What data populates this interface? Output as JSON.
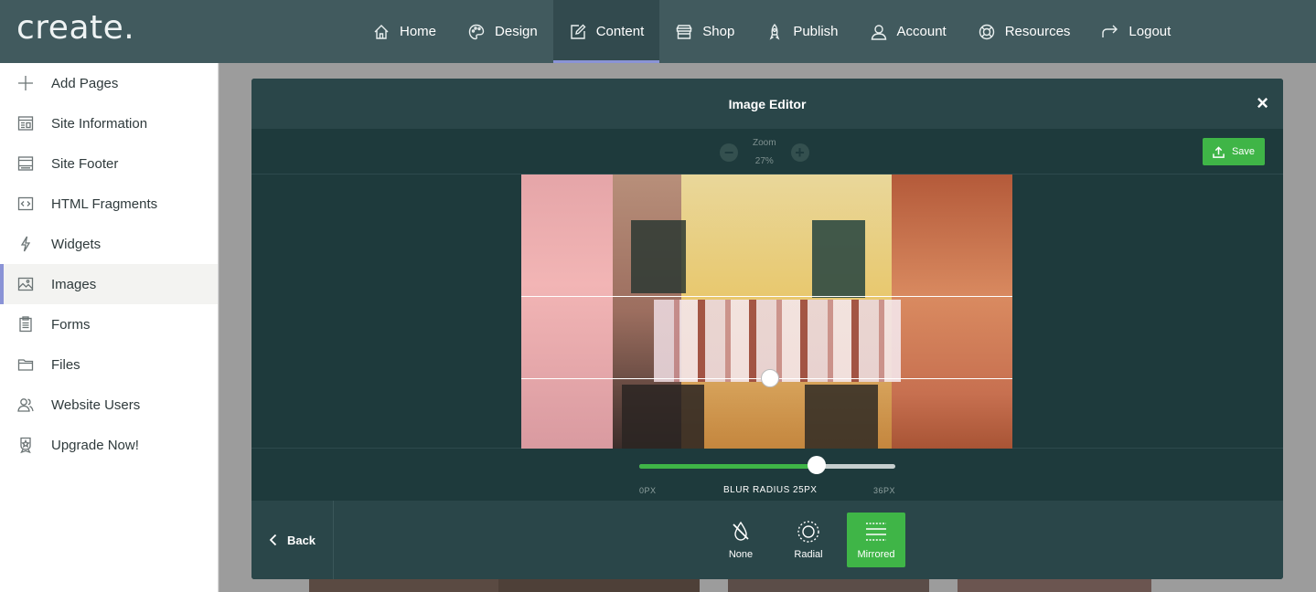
{
  "app": {
    "logo": "create."
  },
  "nav": [
    {
      "label": "Home",
      "icon": "home-icon"
    },
    {
      "label": "Design",
      "icon": "palette-icon"
    },
    {
      "label": "Content",
      "icon": "edit-icon",
      "active": true
    },
    {
      "label": "Shop",
      "icon": "shop-icon"
    },
    {
      "label": "Publish",
      "icon": "rocket-icon"
    },
    {
      "label": "Account",
      "icon": "user-icon"
    },
    {
      "label": "Resources",
      "icon": "lifebuoy-icon"
    },
    {
      "label": "Logout",
      "icon": "logout-icon"
    }
  ],
  "sidebar": [
    {
      "label": "Add Pages",
      "icon": "plus-icon"
    },
    {
      "label": "Site Information",
      "icon": "site-info-icon"
    },
    {
      "label": "Site Footer",
      "icon": "footer-icon"
    },
    {
      "label": "HTML Fragments",
      "icon": "code-icon"
    },
    {
      "label": "Widgets",
      "icon": "lightning-icon"
    },
    {
      "label": "Images",
      "icon": "image-icon",
      "active": true
    },
    {
      "label": "Forms",
      "icon": "clipboard-icon"
    },
    {
      "label": "Files",
      "icon": "folder-icon"
    },
    {
      "label": "Website Users",
      "icon": "users-icon"
    },
    {
      "label": "Upgrade Now!",
      "icon": "award-icon"
    }
  ],
  "modal": {
    "title": "Image Editor",
    "close": "×",
    "zoom": {
      "label": "Zoom",
      "value": "27%",
      "minus": "−",
      "plus": "+"
    },
    "save_label": "Save",
    "blur": {
      "min_label": "0PX",
      "max_label": "36PX",
      "current_label": "BLUR RADIUS 25PX",
      "min": 0,
      "max": 36,
      "value": 25
    },
    "back_label": "Back",
    "modes": [
      {
        "label": "None",
        "icon": "no-drop-icon"
      },
      {
        "label": "Radial",
        "icon": "radial-icon"
      },
      {
        "label": "Mirrored",
        "icon": "mirrored-icon",
        "active": true
      }
    ]
  },
  "colors": {
    "topbar": "#415a5e",
    "accent_green": "#3fb547",
    "active_indicator": "#8a93d6",
    "modal_bg": "#1f3b3d"
  }
}
